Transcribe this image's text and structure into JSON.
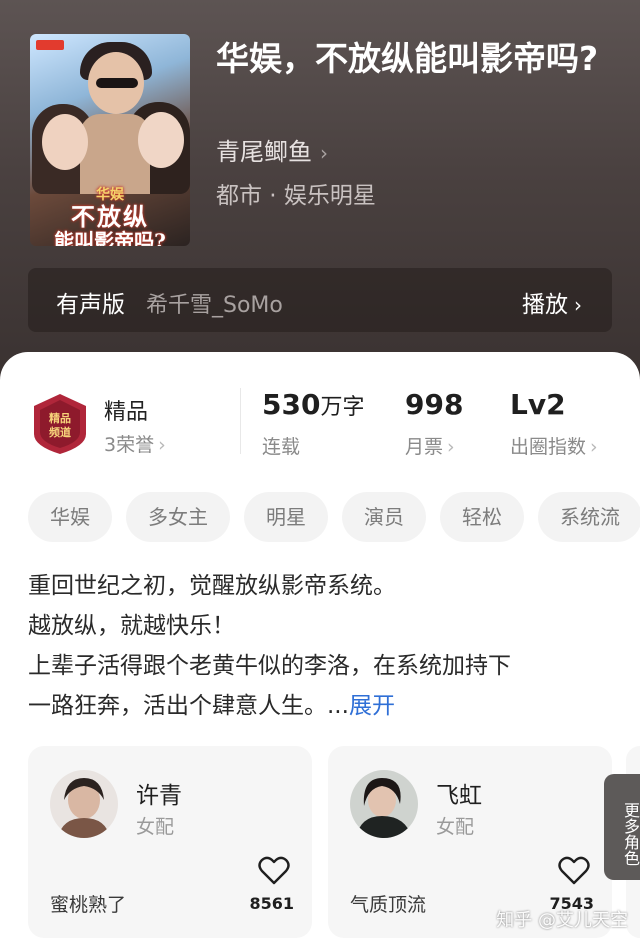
{
  "book": {
    "title": "华娱，不放纵能叫影帝吗?",
    "author": "青尾鲫鱼",
    "category": "都市 · 娱乐明星",
    "cover_text": {
      "line0": "华娱",
      "line1": "不放纵",
      "line2": "能叫影帝吗?"
    }
  },
  "audio": {
    "label": "有声版",
    "narrator": "希千雪_SoMo",
    "play_label": "播放"
  },
  "quality": {
    "label": "精品",
    "honor": "3荣誉",
    "seal_text": "精品频道"
  },
  "stats": [
    {
      "value": "530",
      "unit": "万字",
      "label": "连载"
    },
    {
      "value": "998",
      "unit": "",
      "label": "月票"
    },
    {
      "value": "Lv2",
      "unit": "",
      "label": "出圈指数"
    }
  ],
  "tags": [
    "华娱",
    "多女主",
    "明星",
    "演员",
    "轻松",
    "系统流"
  ],
  "synopsis": {
    "lines": [
      "重回世纪之初，觉醒放纵影帝系统。",
      "越放纵，就越快乐！",
      "上辈子活得跟个老黄牛似的李洛，在系统加持下",
      "一路狂奔，活出个肆意人生。..."
    ],
    "expand_label": "展开"
  },
  "characters": [
    {
      "name": "许青",
      "role": "女配",
      "description": "蜜桃熟了",
      "likes": "8561"
    },
    {
      "name": "飞虹",
      "role": "女配",
      "description": "气质顶流",
      "likes": "7543"
    }
  ],
  "more_roles_label": "更多角色",
  "watermark": "知乎 @艾儿天空",
  "colors": {
    "header_bg": "#4a4140",
    "expand_link": "#2f6fd6",
    "tag_bg": "#f3f3f3"
  }
}
